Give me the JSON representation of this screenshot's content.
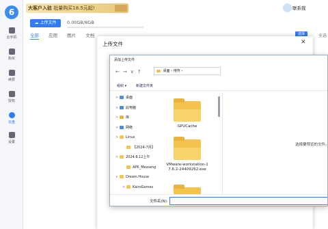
{
  "app": {
    "logo": "6"
  },
  "leftnav": {
    "items": [
      {
        "label": "云手机",
        "icon": "phone-icon"
      },
      {
        "label": "购买",
        "icon": "cart-icon"
      },
      {
        "label": "续费",
        "icon": "renew-icon"
      },
      {
        "label": "授权",
        "icon": "auth-icon"
      },
      {
        "label": "云盘",
        "icon": "cloud-icon",
        "active": true
      },
      {
        "label": "设置",
        "icon": "gear-icon"
      }
    ]
  },
  "header": {
    "promo_title": "大客户入驻",
    "promo_text": "批量购买18.5元起!",
    "contact_label": "联系我"
  },
  "toolbar": {
    "upload_button": "上传文件",
    "storage_text": "0.00GB/8GB",
    "storage_used_fraction": 0
  },
  "tabs": [
    "全部",
    "应用",
    "图片",
    "文档"
  ],
  "actions": {
    "select": "选择",
    "select_all": "全选"
  },
  "upload_modal": {
    "title": "上传文件",
    "close": "✕"
  },
  "file_dialog": {
    "title": "添加上传文件",
    "nav": "←→∨↑",
    "path": [
      "桌面",
      "待传"
    ],
    "commands": {
      "organize": "组织 ▾",
      "new_folder": "新建文件夹"
    },
    "tree": [
      {
        "label": "桌面",
        "indent": 1,
        "chevron": ">",
        "color": "#4a90d9"
      },
      {
        "label": "此电脑",
        "indent": 1,
        "chevron": ">",
        "color": "#4a90d9"
      },
      {
        "label": "库",
        "indent": 1,
        "chevron": ">",
        "color": "#e8b340"
      },
      {
        "label": "网络",
        "indent": 1,
        "chevron": ">",
        "color": "#4a90d9"
      },
      {
        "label": "Linux",
        "indent": 1,
        "chevron": ">",
        "color": "#f3c34e"
      },
      {
        "label": "【2024-7月】",
        "indent": 2,
        "chevron": "",
        "color": "#f3c34e"
      },
      {
        "label": "2024.8.12上午",
        "indent": 1,
        "chevron": ">",
        "color": "#f3c34e"
      },
      {
        "label": "APK_Messeng",
        "indent": 2,
        "chevron": "",
        "color": "#f3c34e"
      },
      {
        "label": "Dream.House",
        "indent": 1,
        "chevron": "∨",
        "color": "#f3c34e"
      },
      {
        "label": "KairoGames",
        "indent": 2,
        "chevron": ">",
        "color": "#f3c34e"
      }
    ],
    "files": [
      {
        "name": "GPUCache"
      },
      {
        "name": "VMware-workstation-17.6.2-24409262.exe"
      },
      {
        "name": ""
      }
    ],
    "preview_hint": "选择要预览的文件。",
    "filename_label": "文件名(N):",
    "filename_value": ""
  }
}
